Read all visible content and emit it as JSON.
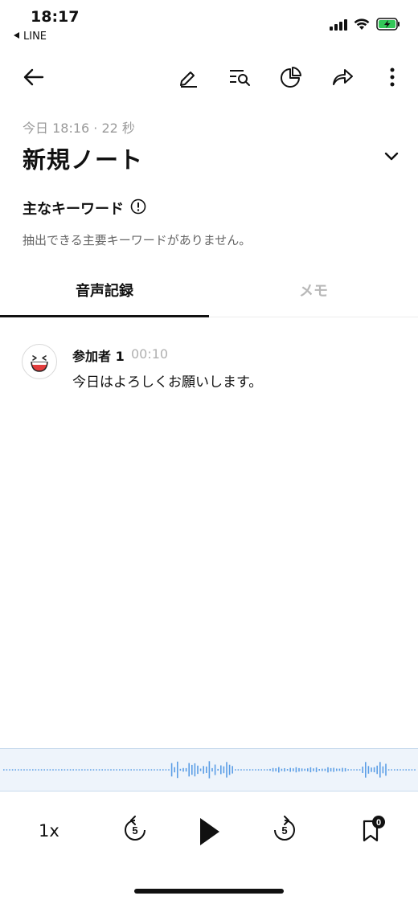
{
  "status_bar": {
    "time": "18:17",
    "back_app": "LINE",
    "icons": [
      "signal-icon",
      "wifi-icon",
      "battery-charging-icon"
    ]
  },
  "header": {
    "icons": [
      "back-arrow-icon",
      "edit-icon",
      "search-transcript-icon",
      "summary-chart-icon",
      "share-icon",
      "more-icon"
    ]
  },
  "note": {
    "meta": "今日 18:16 · 22 秒",
    "title": "新規ノート"
  },
  "keywords": {
    "title": "主なキーワード",
    "empty_message": "抽出できる主要キーワードがありません。"
  },
  "tabs": [
    {
      "label": "音声記録",
      "active": true
    },
    {
      "label": "メモ",
      "active": false
    }
  ],
  "transcript": [
    {
      "speaker": "参加者 1",
      "time": "00:10",
      "text": "今日はよろしくお願いします。"
    }
  ],
  "player": {
    "speed": "1x",
    "rewind_seconds": "5",
    "forward_seconds": "5",
    "bookmark_count": "0"
  },
  "colors": {
    "waveform": "#5b9ee6",
    "waveform_bg": "#eef4fb"
  }
}
